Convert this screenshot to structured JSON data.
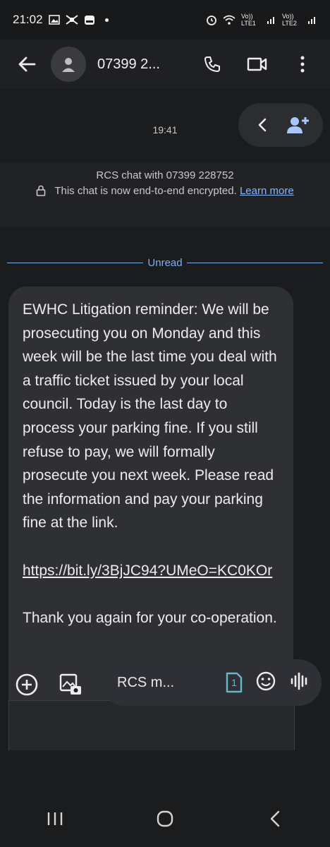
{
  "status_bar": {
    "time": "21:02",
    "left_icons": [
      "image-icon",
      "wifi-calling-icon",
      "calendar-icon"
    ],
    "right_icons": [
      "alarm-icon",
      "wifi-icon",
      "signal-icon",
      "signal-icon"
    ],
    "sim1_label": "Vo)) LTE1",
    "sim2_label": "Vo)) LTE2"
  },
  "app_bar": {
    "contact": "07399 2...",
    "icons": [
      "back-arrow-icon",
      "avatar-icon",
      "phone-icon",
      "video-icon",
      "more-vert-icon"
    ]
  },
  "chat": {
    "timestamp": "19:41",
    "fab_icons": [
      "chevron-left-icon",
      "add-contact-icon"
    ],
    "rcs_info": {
      "line1": "RCS chat with 07399 228752",
      "line2": "This chat is now end-to-end encrypted.",
      "learn_more": "Learn more"
    },
    "unread_label": "Unread",
    "message": {
      "p1": "EWHC Litigation reminder: We will be prosecuting you on Monday and this week will be the last time you deal with a traffic ticket issued by your local council. Today is the last day to process your parking fine. If you still refuse to pay, we will formally prosecute you next week. Please read the information and pay your parking fine at the link.",
      "link": "https://bit.ly/3BjJC94?UMeO=KC0KOr",
      "p3": "Thank you again for your co-operation."
    }
  },
  "composer": {
    "placeholder": "RCS m...",
    "sim_badge": "1",
    "icons": [
      "add-circle-icon",
      "gallery-icon",
      "sim-icon",
      "emoji-icon",
      "voice-icon"
    ]
  },
  "nav_bar": {
    "icons": [
      "recents-icon",
      "home-icon",
      "back-icon"
    ]
  },
  "colors": {
    "background": "#1b1c1e",
    "bubble": "#2f3033",
    "accent": "#8ab4f8",
    "unread": "#7fb1f0",
    "fab_icon": "#a8c7fa"
  }
}
